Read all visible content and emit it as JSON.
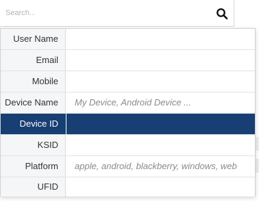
{
  "search": {
    "placeholder": "Search...",
    "value": ""
  },
  "fields": [
    {
      "label": "User Name",
      "placeholder": "",
      "selected": false
    },
    {
      "label": "Email",
      "placeholder": "",
      "selected": false
    },
    {
      "label": "Mobile",
      "placeholder": "",
      "selected": false
    },
    {
      "label": "Device Name",
      "placeholder": "My Device, Android Device ...",
      "selected": false
    },
    {
      "label": "Device ID",
      "placeholder": "",
      "selected": true
    },
    {
      "label": "KSID",
      "placeholder": "",
      "selected": false
    },
    {
      "label": "Platform",
      "placeholder": "apple, android, blackberry, windows, web",
      "selected": false
    },
    {
      "label": "UFID",
      "placeholder": "",
      "selected": false
    }
  ],
  "colors": {
    "selected_bg": "#173f73",
    "label_bg": "#f4f6f8"
  },
  "icons": {
    "search": "search-icon"
  }
}
